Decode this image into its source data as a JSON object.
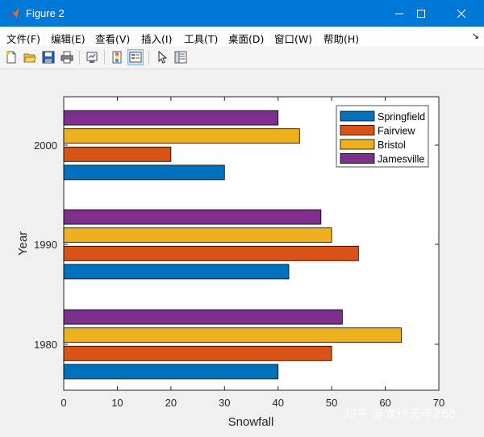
{
  "window": {
    "title": "Figure 2",
    "controls": [
      "minimize-icon",
      "maximize-icon",
      "close-icon"
    ]
  },
  "menu": {
    "items": [
      "文件(F)",
      "编辑(E)",
      "查看(V)",
      "插入(I)",
      "工具(T)",
      "桌面(D)",
      "窗口(W)",
      "帮助(H)"
    ],
    "overflow": "↘"
  },
  "toolbar": {
    "icons": [
      "new-figure-icon",
      "open-file-icon",
      "save-icon",
      "print-icon",
      "link-plot-icon",
      "insert-colorbar-icon",
      "insert-legend-icon",
      "edit-plot-arrow-icon",
      "property-inspector-icon"
    ]
  },
  "watermark": "知乎 @龙待天卒288",
  "chart_data": {
    "type": "bar",
    "orientation": "horizontal",
    "categories": [
      "1980",
      "1990",
      "2000"
    ],
    "series": [
      {
        "name": "Springfield",
        "color": "#0072bd",
        "values": [
          40,
          42,
          30
        ]
      },
      {
        "name": "Fairview",
        "color": "#d95319",
        "values": [
          50,
          55,
          20
        ]
      },
      {
        "name": "Bristol",
        "color": "#edb120",
        "values": [
          63,
          50,
          44
        ]
      },
      {
        "name": "Jamesville",
        "color": "#7e2f8e",
        "values": [
          52,
          48,
          40
        ]
      }
    ],
    "xlabel": "Snowfall",
    "ylabel": "Year",
    "xlim": [
      0,
      70
    ],
    "xticks": [
      "0",
      "10",
      "20",
      "30",
      "40",
      "50",
      "60",
      "70"
    ],
    "grid": false,
    "legend_position": "top-right"
  }
}
